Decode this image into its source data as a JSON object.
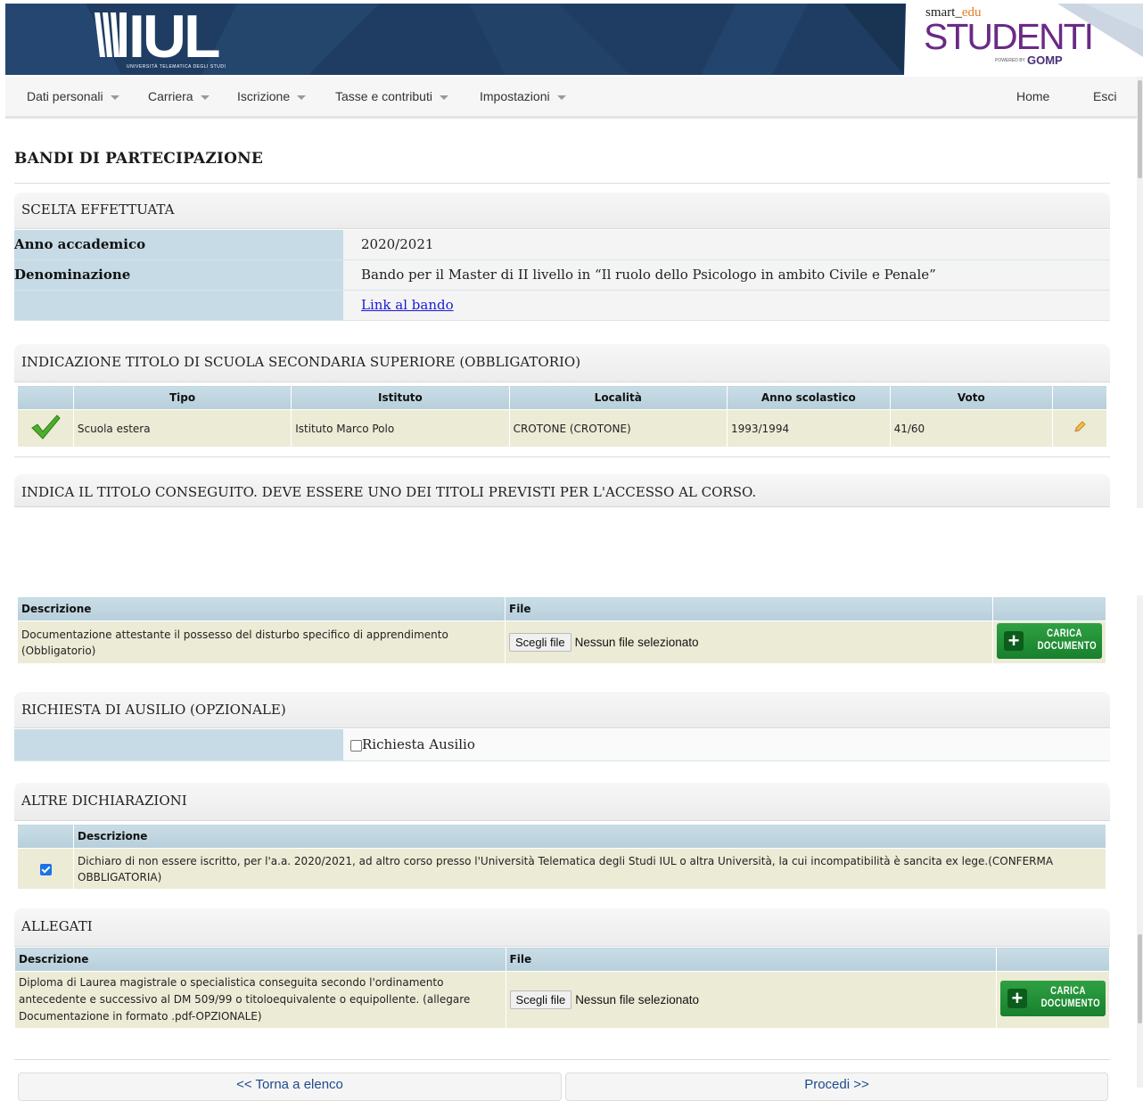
{
  "header": {
    "logo_text": "IUL",
    "logo_subtitle": "UNIVERSITÀ TELEMATICA DEGLI STUDI",
    "brand_smart": "smart",
    "brand_edu": "edu",
    "brand_title": "STUDENTI",
    "brand_powered": "POWERED BY",
    "brand_gomp": "GOMP",
    "colors": {
      "banner": "#1e3b5f",
      "brand_purple": "#6a2a86"
    }
  },
  "nav": {
    "items": [
      "Dati personali",
      "Carriera",
      "Iscrizione",
      "Tasse e contributi",
      "Impostazioni"
    ],
    "right": [
      "Home",
      "Esci"
    ]
  },
  "page_title": "BANDI DI PARTECIPAZIONE",
  "scelta": {
    "heading": "SCELTA EFFETTUATA",
    "rows": [
      {
        "label": "Anno accademico",
        "value": "2020/2021"
      },
      {
        "label": "Denominazione",
        "value": "Bando per il Master di II livello in “Il ruolo dello Psicologo in ambito Civile e Penale”"
      },
      {
        "label": "",
        "value": "Link al bando"
      }
    ]
  },
  "titolo_scuola": {
    "heading": "INDICAZIONE TITOLO DI SCUOLA SECONDARIA SUPERIORE (OBBLIGATORIO)",
    "columns": [
      "Tipo",
      "Istituto",
      "Località",
      "Anno scolastico",
      "Voto"
    ],
    "rows": [
      {
        "tipo": "Scuola estera",
        "istituto": "Istituto Marco Polo",
        "localita": "CROTONE (CROTONE)",
        "anno": "1993/1994",
        "voto": "41/60",
        "status_icon": "checkmark-icon",
        "action_icon": "pencil-icon"
      }
    ]
  },
  "titolo_conseguito": {
    "heading": "INDICA IL TITOLO CONSEGUITO. DEVE ESSERE UNO DEI TITOLI PREVISTI PER L'ACCESSO AL CORSO."
  },
  "documentazione": {
    "columns": [
      "Descrizione",
      "File"
    ],
    "rows": [
      {
        "descrizione": "Documentazione attestante il possesso del disturbo specifico di apprendimento (Obbligatorio)",
        "file_button": "Scegli file",
        "file_status": "Nessun file selezionato",
        "upload_label_1": "CARICA",
        "upload_label_2": "DOCUMENTO"
      }
    ]
  },
  "ausilio": {
    "heading": "RICHIESTA DI AUSILIO (OPZIONALE)",
    "checkbox_label": "Richiesta Ausilio",
    "checked": false
  },
  "dichiarazioni": {
    "heading": "ALTRE DICHIARAZIONI",
    "columns": [
      "Descrizione"
    ],
    "rows": [
      {
        "checked": true,
        "descrizione": "Dichiaro di non essere iscritto, per l'a.a. 2020/2021, ad altro corso presso l'Università Telematica degli Studi IUL o altra Università, la cui incompatibilità è sancita ex lege.(CONFERMA OBBLIGATORIA)"
      }
    ]
  },
  "allegati": {
    "heading": "ALLEGATI",
    "columns": [
      "Descrizione",
      "File"
    ],
    "rows": [
      {
        "descrizione": "Diploma di Laurea magistrale o specialistica conseguita secondo l'ordinamento antecedente e successivo al DM 509/99 o titoloequivalente o equipollente. (allegare Documentazione in formato .pdf-OPZIONALE)",
        "file_button": "Scegli file",
        "file_status": "Nessun file selezionato",
        "upload_label_1": "CARICA",
        "upload_label_2": "DOCUMENTO"
      }
    ]
  },
  "footer": {
    "back": "<< Torna a elenco",
    "next": "Procedi >>"
  }
}
